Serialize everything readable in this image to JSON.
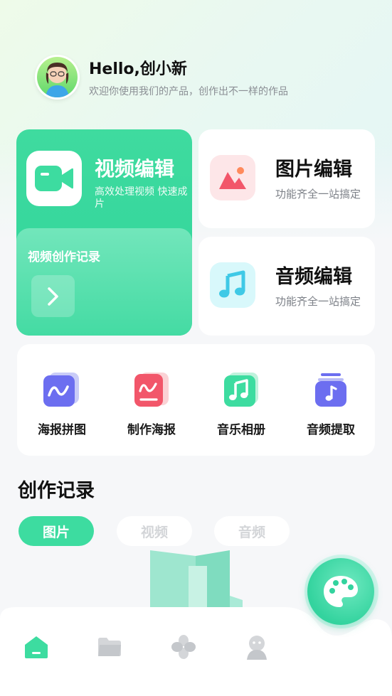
{
  "header": {
    "greeting": "Hello,创小新",
    "subtitle": "欢迎你使用我们的产品，创作出不一样的作品"
  },
  "video_card": {
    "title": "视频编辑",
    "description": "高效处理视频 快速成片",
    "record_label": "视频创作记录",
    "icon": "video-camera-icon"
  },
  "image_card": {
    "title": "图片编辑",
    "description": "功能齐全一站搞定",
    "icon": "image-icon"
  },
  "audio_card": {
    "title": "音频编辑",
    "description": "功能齐全一站搞定",
    "icon": "music-note-icon"
  },
  "tools": [
    {
      "label": "海报拼图",
      "icon": "poster-collage-icon"
    },
    {
      "label": "制作海报",
      "icon": "make-poster-icon"
    },
    {
      "label": "音乐相册",
      "icon": "music-album-icon"
    },
    {
      "label": "音频提取",
      "icon": "audio-extract-icon"
    }
  ],
  "records": {
    "title": "创作记录",
    "tabs": [
      "图片",
      "视频",
      "音频"
    ],
    "active_tab": "图片"
  },
  "nav": {
    "items": [
      "home-icon",
      "folder-icon",
      "apps-icon",
      "profile-icon"
    ],
    "active": "home-icon"
  },
  "colors": {
    "accent": "#3ddca0",
    "text_primary": "#111111",
    "text_secondary": "#7d8188"
  }
}
